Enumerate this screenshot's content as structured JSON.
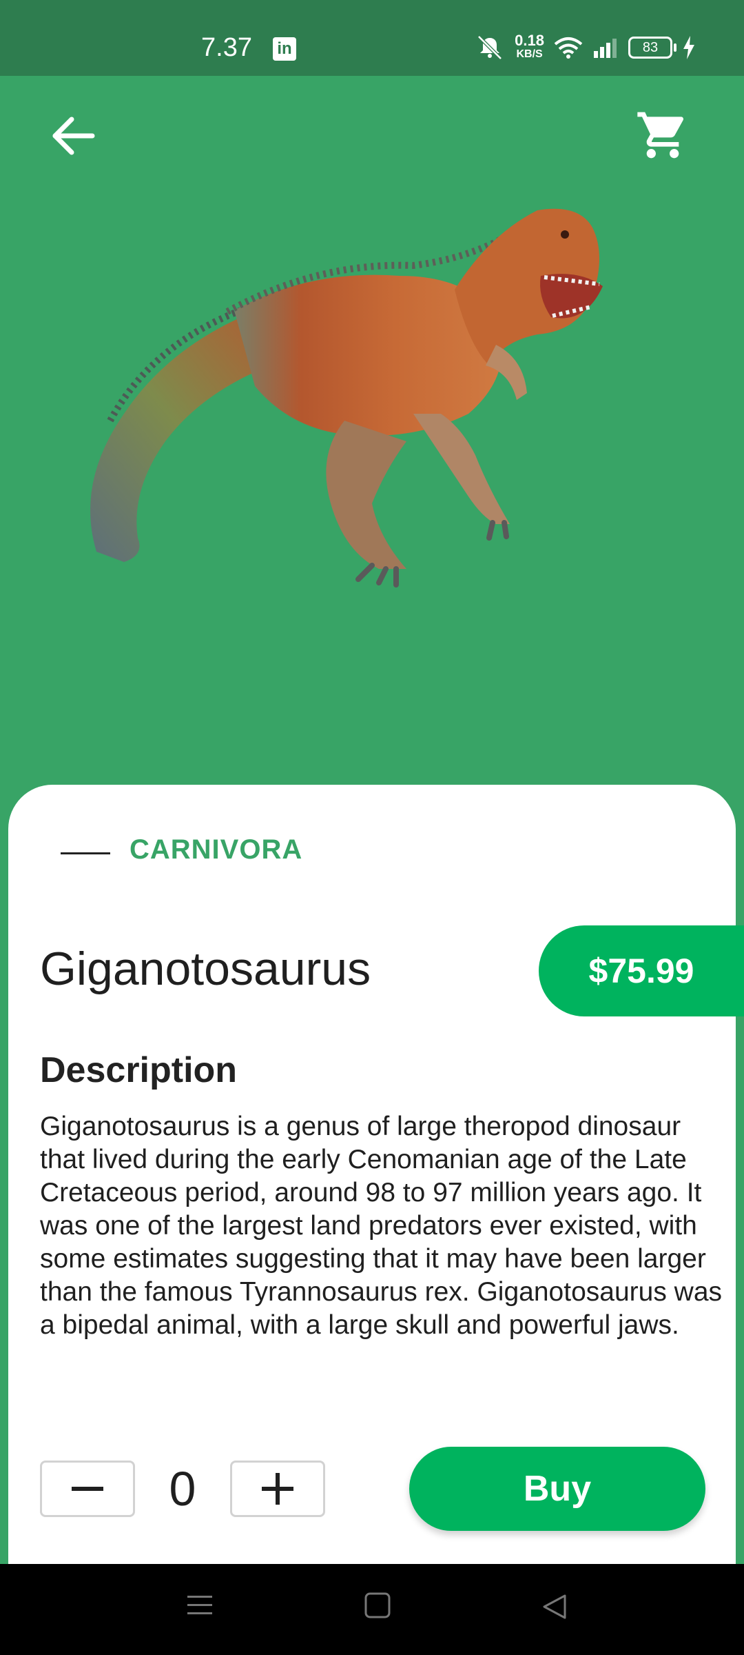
{
  "status_bar": {
    "time": "7.37",
    "linkedin_glyph": "in",
    "net_speed_value": "0.18",
    "net_speed_unit": "KB/S",
    "battery": "83",
    "icons": [
      "linkedin-icon",
      "bell-muted-icon",
      "wifi-icon",
      "signal-icon",
      "battery-icon",
      "charging-icon"
    ]
  },
  "toolbar": {
    "back_icon": "arrow-left-icon",
    "cart_icon": "shopping-cart-icon"
  },
  "product": {
    "category": "CARNIVORA",
    "name": "Giganotosaurus",
    "price": "$75.99",
    "description_heading": "Description",
    "description": "Giganotosaurus is a genus of large theropod dinosaur that lived during the early Cenomanian age of the Late Cretaceous period, around 98 to 97 million years ago. It was one of the largest land predators ever existed, with some estimates suggesting that it may have been larger than the famous Tyrannosaurus rex. Giganotosaurus was a bipedal animal, with a large skull and powerful jaws."
  },
  "cart_controls": {
    "quantity": "0",
    "minus_icon": "minus-icon",
    "plus_icon": "plus-icon",
    "buy_label": "Buy"
  },
  "colors": {
    "background": "#38a466",
    "accent": "#00b35e",
    "status_bar": "#2e7d4f"
  }
}
